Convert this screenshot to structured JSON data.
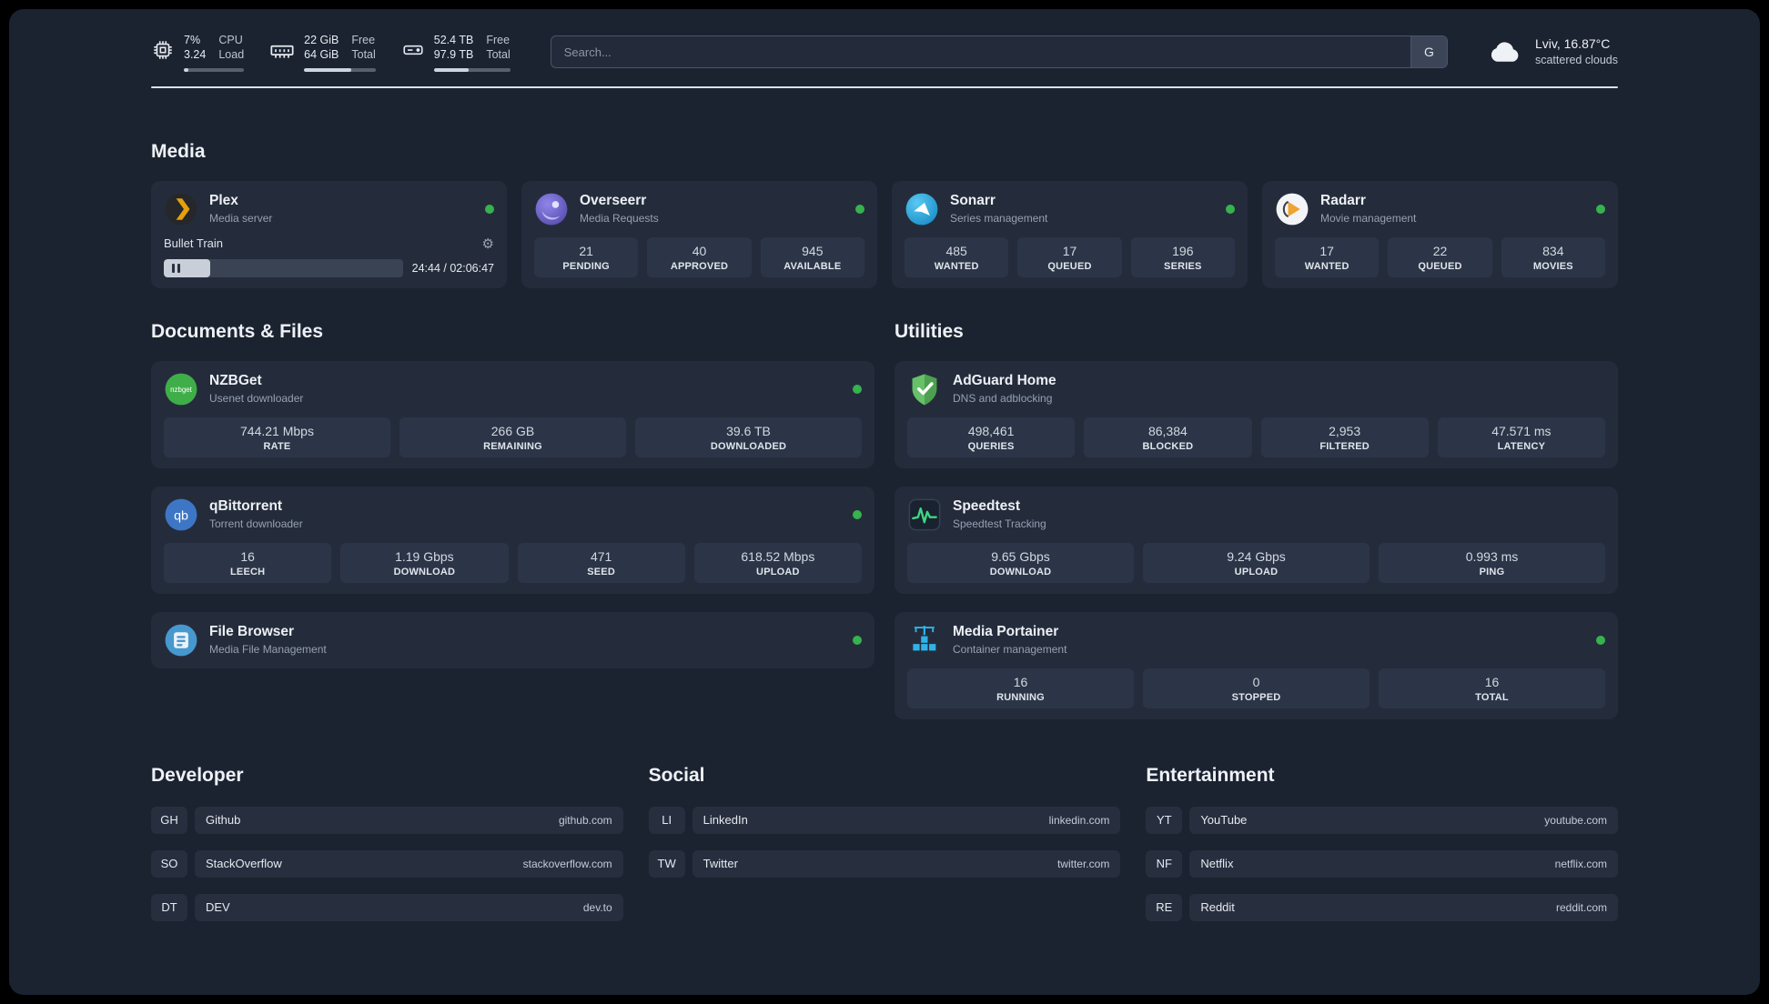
{
  "topbar": {
    "cpu": {
      "value_primary": "7%",
      "value_secondary": "3.24",
      "label_primary": "CPU",
      "label_secondary": "Load",
      "usage_percent": 7
    },
    "ram": {
      "value_primary": "22 GiB",
      "value_secondary": "64 GiB",
      "label_primary": "Free",
      "label_secondary": "Total",
      "usage_percent": 66
    },
    "disk": {
      "value_primary": "52.4 TB",
      "value_secondary": "97.9 TB",
      "label_primary": "Free",
      "label_secondary": "Total",
      "usage_percent": 46
    },
    "search": {
      "placeholder": "Search...",
      "provider_button": "G"
    },
    "weather": {
      "location": "Lviv, 16.87°C",
      "condition": "scattered clouds"
    }
  },
  "media": {
    "title": "Media",
    "plex": {
      "name": "Plex",
      "subtitle": "Media server",
      "now_playing": "Bullet Train",
      "elapsed_total": "24:44 / 02:06:47",
      "progress_percent": 19.5
    },
    "overseerr": {
      "name": "Overseerr",
      "subtitle": "Media Requests",
      "stats": [
        {
          "value": "21",
          "label": "PENDING"
        },
        {
          "value": "40",
          "label": "APPROVED"
        },
        {
          "value": "945",
          "label": "AVAILABLE"
        }
      ]
    },
    "sonarr": {
      "name": "Sonarr",
      "subtitle": "Series management",
      "stats": [
        {
          "value": "485",
          "label": "WANTED"
        },
        {
          "value": "17",
          "label": "QUEUED"
        },
        {
          "value": "196",
          "label": "SERIES"
        }
      ]
    },
    "radarr": {
      "name": "Radarr",
      "subtitle": "Movie management",
      "stats": [
        {
          "value": "17",
          "label": "WANTED"
        },
        {
          "value": "22",
          "label": "QUEUED"
        },
        {
          "value": "834",
          "label": "MOVIES"
        }
      ]
    }
  },
  "documents": {
    "title": "Documents & Files",
    "nzbget": {
      "name": "NZBGet",
      "subtitle": "Usenet downloader",
      "icon_text": "nzbget",
      "stats": [
        {
          "value": "744.21 Mbps",
          "label": "RATE"
        },
        {
          "value": "266 GB",
          "label": "REMAINING"
        },
        {
          "value": "39.6 TB",
          "label": "DOWNLOADED"
        }
      ]
    },
    "qbittorrent": {
      "name": "qBittorrent",
      "subtitle": "Torrent downloader",
      "icon_text": "qb",
      "stats": [
        {
          "value": "16",
          "label": "LEECH"
        },
        {
          "value": "1.19 Gbps",
          "label": "DOWNLOAD"
        },
        {
          "value": "471",
          "label": "SEED"
        },
        {
          "value": "618.52 Mbps",
          "label": "UPLOAD"
        }
      ]
    },
    "filebrowser": {
      "name": "File Browser",
      "subtitle": "Media File Management"
    }
  },
  "utilities": {
    "title": "Utilities",
    "adguard": {
      "name": "AdGuard Home",
      "subtitle": "DNS and adblocking",
      "stats": [
        {
          "value": "498,461",
          "label": "QUERIES"
        },
        {
          "value": "86,384",
          "label": "BLOCKED"
        },
        {
          "value": "2,953",
          "label": "FILTERED"
        },
        {
          "value": "47.571 ms",
          "label": "LATENCY"
        }
      ]
    },
    "speedtest": {
      "name": "Speedtest",
      "subtitle": "Speedtest Tracking",
      "stats": [
        {
          "value": "9.65 Gbps",
          "label": "DOWNLOAD"
        },
        {
          "value": "9.24 Gbps",
          "label": "UPLOAD"
        },
        {
          "value": "0.993 ms",
          "label": "PING"
        }
      ]
    },
    "portainer": {
      "name": "Media Portainer",
      "subtitle": "Container management",
      "stats": [
        {
          "value": "16",
          "label": "RUNNING"
        },
        {
          "value": "0",
          "label": "STOPPED"
        },
        {
          "value": "16",
          "label": "TOTAL"
        }
      ]
    }
  },
  "bookmarks": {
    "developer": {
      "title": "Developer",
      "items": [
        {
          "abbr": "GH",
          "name": "Github",
          "url": "github.com"
        },
        {
          "abbr": "SO",
          "name": "StackOverflow",
          "url": "stackoverflow.com"
        },
        {
          "abbr": "DT",
          "name": "DEV",
          "url": "dev.to"
        }
      ]
    },
    "social": {
      "title": "Social",
      "items": [
        {
          "abbr": "LI",
          "name": "LinkedIn",
          "url": "linkedin.com"
        },
        {
          "abbr": "TW",
          "name": "Twitter",
          "url": "twitter.com"
        }
      ]
    },
    "entertainment": {
      "title": "Entertainment",
      "items": [
        {
          "abbr": "YT",
          "name": "YouTube",
          "url": "youtube.com"
        },
        {
          "abbr": "NF",
          "name": "Netflix",
          "url": "netflix.com"
        },
        {
          "abbr": "RE",
          "name": "Reddit",
          "url": "reddit.com"
        }
      ]
    }
  },
  "colors": {
    "status_online": "#37b24d",
    "plex_accent": "#e5a00d",
    "overseerr_accent": "#5f54d0",
    "sonarr_accent": "#1e9fdb",
    "radarr_accent": "#f0a32e",
    "nzbget_accent": "#3fae49",
    "qbittorrent_accent": "#3e76c6",
    "filebrowser_accent": "#4798ce",
    "adguard_accent": "#5cb85c",
    "speedtest_line": "#3fd684",
    "portainer_accent": "#2fb3e8"
  }
}
